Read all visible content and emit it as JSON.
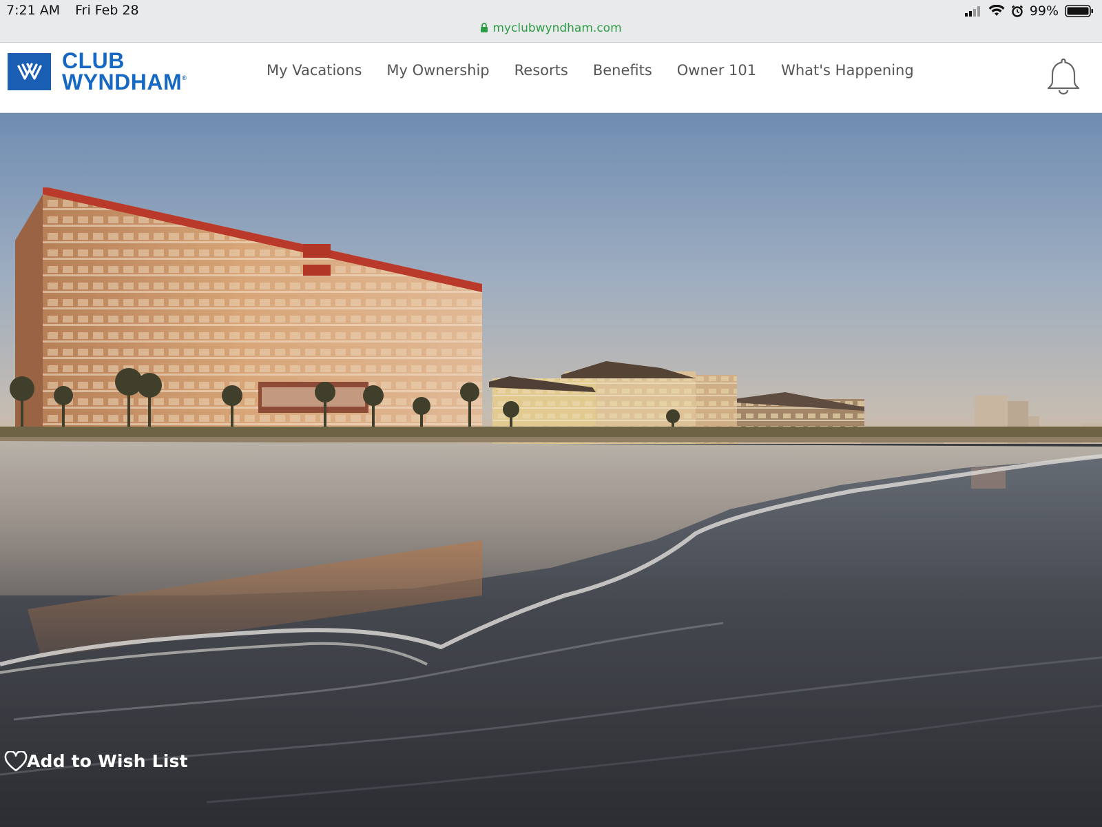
{
  "status_bar": {
    "time": "7:21 AM",
    "date": "Fri Feb 28",
    "battery": "99%",
    "icons": [
      "signal-icon",
      "wifi-icon",
      "alarm-icon",
      "battery-icon"
    ]
  },
  "address_bar": {
    "url": "myclubwyndham.com",
    "icon": "lock-icon",
    "color": "#2e9c46"
  },
  "header": {
    "logo": {
      "line1": "CLUB",
      "line2": "WYNDHAM",
      "mark": "®",
      "color": "#1668c2"
    },
    "nav": [
      {
        "label": "My Vacations"
      },
      {
        "label": "My Ownership"
      },
      {
        "label": "Resorts"
      },
      {
        "label": "Benefits"
      },
      {
        "label": "Owner 101"
      },
      {
        "label": "What's Happening"
      }
    ],
    "notifications_icon": "bell-icon"
  },
  "hero": {
    "image": "beachfront-resort-at-dusk",
    "wishlist": {
      "icon": "heart-icon",
      "label": "Add to Wish List"
    }
  }
}
